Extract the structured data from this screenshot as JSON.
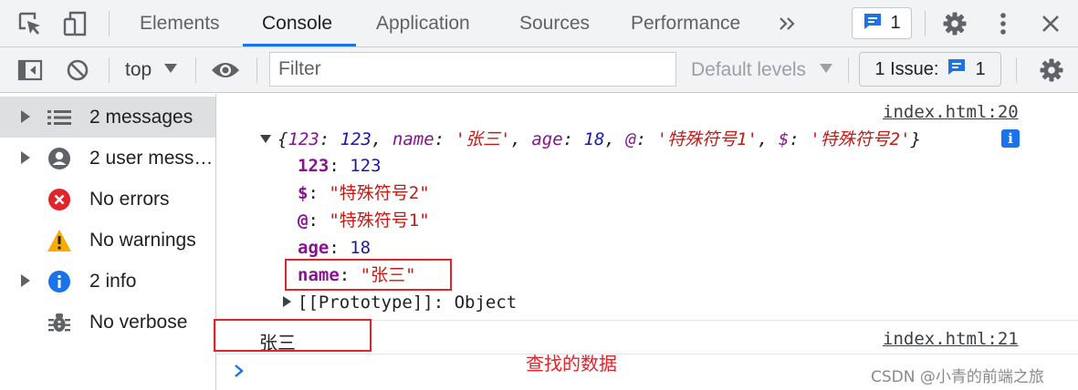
{
  "tabs": [
    "Elements",
    "Console",
    "Application",
    "Sources",
    "Performance"
  ],
  "tab_active": "Console",
  "tab_overflow_icon": "double-chevron-right-icon",
  "message_badge": {
    "icon": "message-icon",
    "count": "1"
  },
  "toolbar": {
    "context": "top",
    "filter_placeholder": "Filter",
    "levels": "Default levels",
    "issues_label": "1 Issue:",
    "issues_count": "1"
  },
  "sidebar": {
    "items": [
      {
        "label": "2 messages",
        "icon": "list-icon",
        "expandable": true,
        "selected": true
      },
      {
        "label": "2 user messages",
        "icon": "user-icon",
        "expandable": true
      },
      {
        "label": "No errors",
        "icon": "error-icon"
      },
      {
        "label": "No warnings",
        "icon": "warning-icon"
      },
      {
        "label": "2 info",
        "icon": "info-icon",
        "expandable": true
      },
      {
        "label": "No verbose",
        "icon": "bug-icon"
      }
    ]
  },
  "console": {
    "entry1_source": "index.html:20",
    "summary": {
      "open": "{",
      "k1": "123",
      "v1": "123",
      "k2": "name",
      "v2": "'张三'",
      "k3": "age",
      "v3": "18",
      "k4": "@",
      "v4": "'特殊符号1'",
      "k5": "$",
      "v5": "'特殊符号2'",
      "close": "}"
    },
    "props": [
      {
        "key": "123",
        "value": "123",
        "type": "number"
      },
      {
        "key": "$",
        "value": "\"特殊符号2\"",
        "type": "string"
      },
      {
        "key": "@",
        "value": "\"特殊符号1\"",
        "type": "string"
      },
      {
        "key": "age",
        "value": "18",
        "type": "number"
      },
      {
        "key": "name",
        "value": "\"张三\"",
        "type": "string"
      }
    ],
    "prototype_key": "[[Prototype]]",
    "prototype_value": "Object",
    "entry2_text": "张三",
    "entry2_source": "index.html:21"
  },
  "annotation": "查找的数据",
  "watermark": "CSDN @小青的前端之旅",
  "colors": {
    "accent": "#1a73e8",
    "highlight": "#e0242a",
    "key": "#881391",
    "string": "#c41a16",
    "number": "#1a1aa6"
  }
}
